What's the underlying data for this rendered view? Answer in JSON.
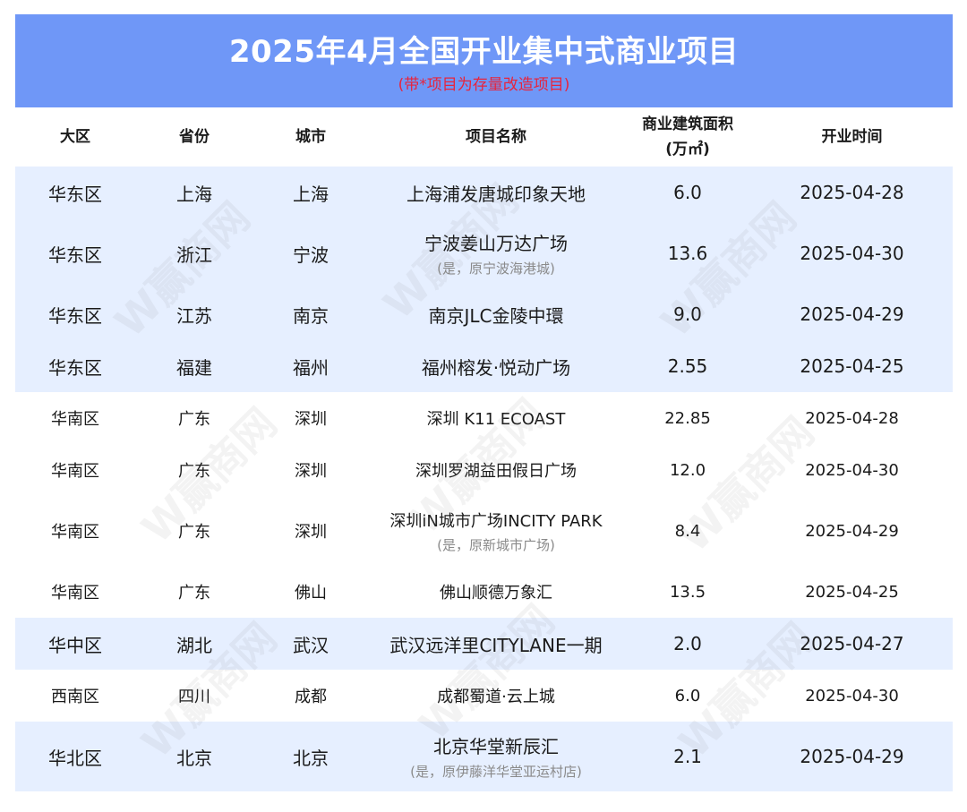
{
  "header": {
    "title": "2025年4月全国开业集中式商业项目",
    "subtitle": "(带*项目为存量改造项目)"
  },
  "columns": {
    "region": "大区",
    "province": "省份",
    "city": "城市",
    "project": "项目名称",
    "area_line1": "商业建筑面积",
    "area_line2": "(万㎡)",
    "open_date": "开业时间"
  },
  "watermark": "W赢商网",
  "rows": [
    {
      "region": "华东区",
      "province": "上海",
      "city": "上海",
      "project": "上海浦发唐城印象天地",
      "note": "",
      "area": "6.0",
      "date": "2025-04-28"
    },
    {
      "region": "华东区",
      "province": "浙江",
      "city": "宁波",
      "project": "宁波姜山万达广场",
      "note": "(是，原宁波海港城)",
      "area": "13.6",
      "date": "2025-04-30"
    },
    {
      "region": "华东区",
      "province": "江苏",
      "city": "南京",
      "project": "南京JLC金陵中環",
      "note": "",
      "area": "9.0",
      "date": "2025-04-29"
    },
    {
      "region": "华东区",
      "province": "福建",
      "city": "福州",
      "project": "福州榕发·悦动广场",
      "note": "",
      "area": "2.55",
      "date": "2025-04-25"
    },
    {
      "region": "华南区",
      "province": "广东",
      "city": "深圳",
      "project": "深圳 K11 ECOAST",
      "note": "",
      "area": "22.85",
      "date": "2025-04-28"
    },
    {
      "region": "华南区",
      "province": "广东",
      "city": "深圳",
      "project": "深圳罗湖益田假日广场",
      "note": "",
      "area": "12.0",
      "date": "2025-04-30"
    },
    {
      "region": "华南区",
      "province": "广东",
      "city": "深圳",
      "project": "深圳iN城市广场INCITY PARK",
      "note": "(是，原新城市广场)",
      "area": "8.4",
      "date": "2025-04-29"
    },
    {
      "region": "华南区",
      "province": "广东",
      "city": "佛山",
      "project": "佛山顺德万象汇",
      "note": "",
      "area": "13.5",
      "date": "2025-04-25"
    },
    {
      "region": "华中区",
      "province": "湖北",
      "city": "武汉",
      "project": "武汉远洋里CITYLANE一期",
      "note": "",
      "area": "2.0",
      "date": "2025-04-27"
    },
    {
      "region": "西南区",
      "province": "四川",
      "city": "成都",
      "project": "成都蜀道·云上城",
      "note": "",
      "area": "6.0",
      "date": "2025-04-30"
    },
    {
      "region": "华北区",
      "province": "北京",
      "city": "北京",
      "project": "北京华堂新辰汇",
      "note": "(是，原伊藤洋华堂亚运村店)",
      "area": "2.1",
      "date": "2025-04-29"
    }
  ]
}
